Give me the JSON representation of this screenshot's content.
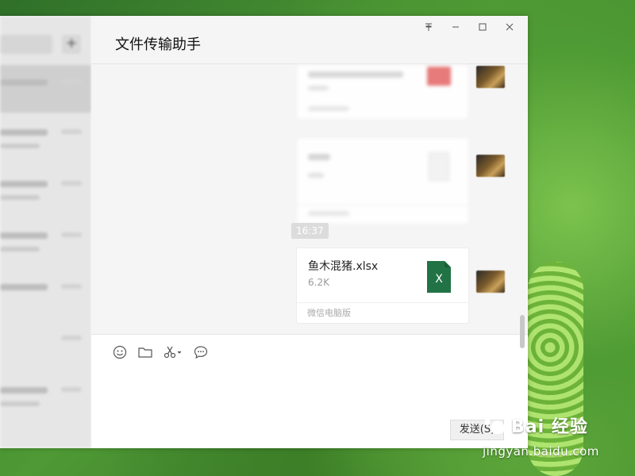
{
  "window": {
    "title": "文件传输助手",
    "controls": {
      "pin_icon": "pin-icon",
      "minimize_icon": "minimize-icon",
      "maximize_icon": "maximize-icon",
      "close_icon": "close-icon"
    }
  },
  "sidebar": {
    "add_label": "+"
  },
  "messages": {
    "timestamp": "16:37",
    "latest_file": {
      "name": "鱼木混猪.xlsx",
      "size": "6.2K",
      "source": "微信电脑版",
      "icon": "excel-file-icon",
      "icon_letter": "X",
      "icon_color": "#217346"
    }
  },
  "input": {
    "tools": [
      "emoji-icon",
      "folder-icon",
      "scissors-icon",
      "chat-bubble-icon"
    ],
    "send_label": "发送(S)"
  },
  "watermark": {
    "brand": "Bai 经验",
    "url": "jingyan.baidu.com"
  }
}
